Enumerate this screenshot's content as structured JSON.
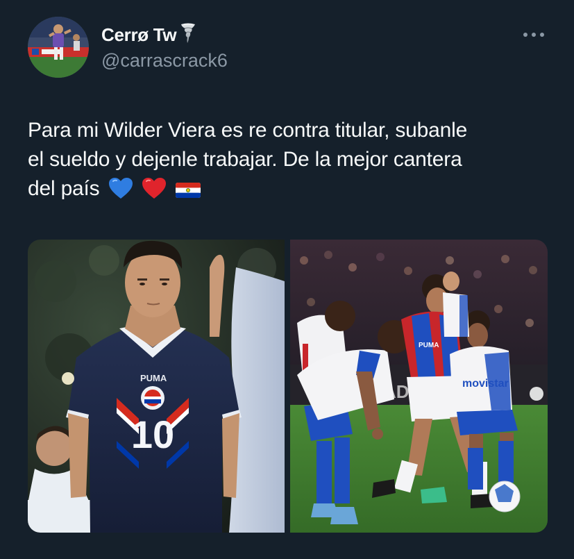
{
  "author": {
    "display_name": "Cerrø Tw",
    "handle": "@carrascrack6",
    "avatar_icon": "profile-photo-soccer-player",
    "badge_icon": "tornado-icon"
  },
  "more_icon": "more-options-icon",
  "tweet": {
    "text_line1": "Para mi Wilder Viera es re contra titular, subanle",
    "text_line2": "el sueldo y dejenle trabajar. De la mejor cantera",
    "text_line3": "del país",
    "emojis": [
      "blue-heart",
      "red-heart",
      "paraguay-flag"
    ]
  },
  "photos": [
    {
      "name": "player-portrait-photo",
      "jersey_brand": "PUMA",
      "jersey_number": "10",
      "jersey_color": "#1c2540"
    },
    {
      "name": "match-action-photo",
      "sponsor": "movistar",
      "colors": {
        "cerro": "#1f4fbf",
        "cerro_red": "#c8262b",
        "pitch": "#3f7a2e"
      }
    }
  ],
  "colors": {
    "background": "#15202b",
    "text_primary": "#f7f9f9",
    "text_secondary": "#8b98a5"
  }
}
